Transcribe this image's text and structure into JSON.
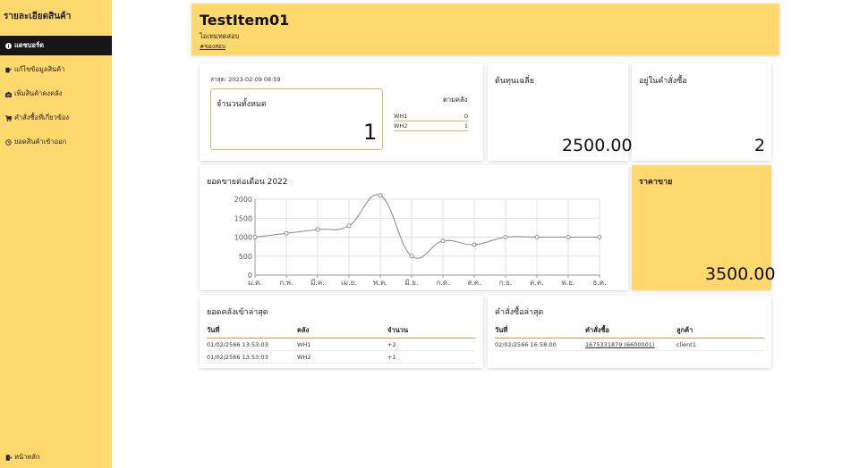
{
  "sidebar": {
    "title": "รายละเอียดสินค้า",
    "items": [
      {
        "label": "แดชบอร์ด",
        "icon": "info-icon"
      },
      {
        "label": "แก้ไขข้อมูลสินค้า",
        "icon": "edit-icon"
      },
      {
        "label": "เพิ่มสินค้าคงคลัง",
        "icon": "warehouse-icon"
      },
      {
        "label": "คำสั่งซื้อที่เกี่ยวข้อง",
        "icon": "cart-icon"
      },
      {
        "label": "ยอดสินค้าเข้าออก",
        "icon": "history-icon"
      }
    ],
    "home_label": "หน้าหลัก"
  },
  "header": {
    "title": "TestItem01",
    "subtitle": "ไอเทมทดสอบ",
    "link": "#ของสอบ"
  },
  "stock": {
    "updated": "ล่าสุด: 2023-02-09 08:59",
    "total_label": "จำนวนทั้งหมด",
    "total_value": "1",
    "by_wh_label": "ตามคลัง",
    "warehouses": [
      {
        "name": "WH1",
        "qty": "0"
      },
      {
        "name": "WH2",
        "qty": "1"
      }
    ]
  },
  "avg_cost": {
    "label": "ต้นทุนเฉลี่ย",
    "value": "2500.00"
  },
  "in_orders": {
    "label": "อยู่ในคำสั่งซื้อ",
    "value": "2"
  },
  "price": {
    "label": "ราคาขาย",
    "value": "3500.00"
  },
  "chart_data": {
    "type": "line",
    "title": "ยอดขายต่อเดือน 2022",
    "xlabel": "",
    "ylabel": "",
    "categories": [
      "ม.ค.",
      "ก.พ.",
      "มี.ค.",
      "เม.ย.",
      "พ.ค.",
      "มิ.ย.",
      "ก.ค.",
      "ส.ค.",
      "ก.ย.",
      "ต.ค.",
      "พ.ย.",
      "ธ.ค."
    ],
    "values": [
      1000,
      1100,
      1200,
      1300,
      2100,
      500,
      900,
      800,
      1000,
      1000,
      1000,
      1000
    ],
    "ylim": [
      0,
      2000
    ],
    "yticks": [
      0,
      500,
      1000,
      1500,
      2000
    ],
    "grid": true,
    "line_color": "#888888"
  },
  "recent_stock": {
    "title": "ยอดคลังเข้าล่าสุด",
    "headers": [
      "วันที่",
      "คลัง",
      "จำนวน"
    ],
    "rows": [
      [
        "01/02/2566 13:53:03",
        "WH1",
        "+2"
      ],
      [
        "01/02/2566 13:53:03",
        "WH2",
        "+1"
      ]
    ]
  },
  "recent_orders": {
    "title": "คำสั่งซื้อล่าสุด",
    "headers": [
      "วันที่",
      "คำสั่งซื้อ",
      "ลูกค้า"
    ],
    "rows": [
      [
        "02/02/2566 16:58:00",
        "1675331879 (6600001)",
        "client1"
      ]
    ]
  },
  "colors": {
    "accent": "#ffd86e",
    "border": "#e6b55b",
    "active_bg": "#161616"
  }
}
